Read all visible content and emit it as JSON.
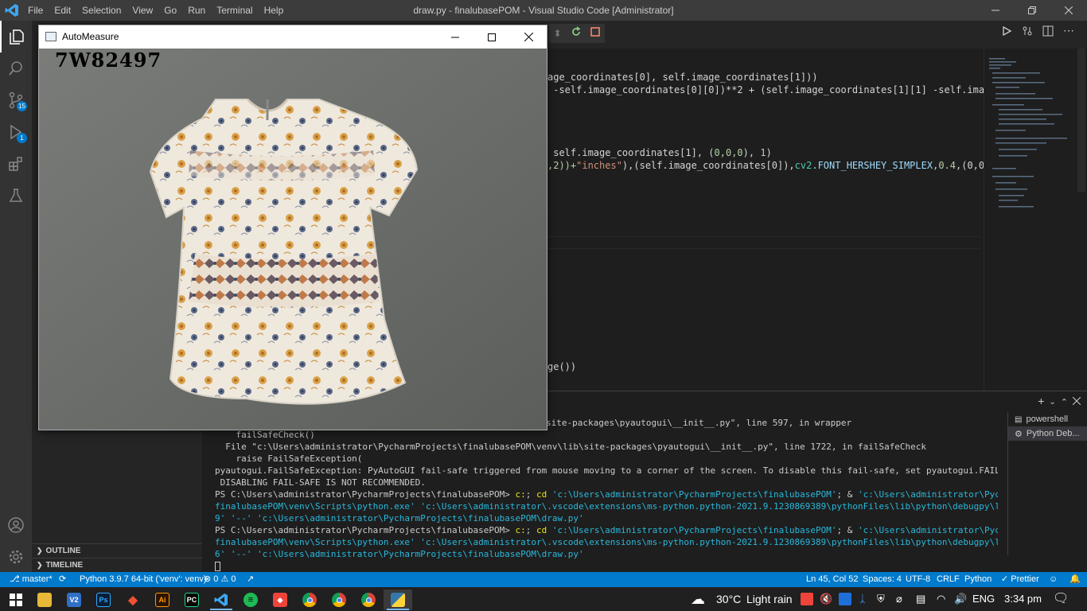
{
  "window": {
    "title": "draw.py - finalubasePOM - Visual Studio Code [Administrator]",
    "menu": [
      "File",
      "Edit",
      "Selection",
      "View",
      "Go",
      "Run",
      "Terminal",
      "Help"
    ]
  },
  "activity": {
    "source_control_badge": "15",
    "debug_badge": "1"
  },
  "sidebar": {
    "outline_label": "OUTLINE",
    "timeline_label": "TIMELINE"
  },
  "editor": {
    "lines": {
      "l1": "age_coordinates[0], self.image_coordinates[1]))",
      "l2": " -self.image_coordinates[0][0])**2 + (self.image_coordinates[1][1] -self.image_coordi",
      "l3a": " self.image_coordinates[1], (",
      "l3b": "0,0,0",
      "l3c": "), ",
      "l3d": "1",
      "l3e": ")",
      "l4a": ",2))+",
      "l4b": "\"inches\"",
      "l4c": "),(self.image_coordinates[0]),",
      "l4d": "cv2",
      "l4e": ".FONT_HERSHEY_SIMPLEX,",
      "l4f": "0.4",
      "l4g": ",(0,0,0),1)",
      "l5": "ge())"
    }
  },
  "terminal": {
    "lines": [
      "site-packages\\pyautogui\\__init__.py\", line 597, in wrapper",
      "    failSafeCheck()",
      "  File \"c:\\Users\\administrator\\PycharmProjects\\finalubasePOM\\venv\\lib\\site-packages\\pyautogui\\__init__.py\", line 1722, in failSafeCheck",
      "    raise FailSafeException(",
      "pyautogui.FailSafeException: PyAutoGUI fail-safe triggered from mouse moving to a corner of the screen. To disable this fail-safe, set pyautogui.FAILSAFE to False.",
      " DISABLING FAIL-SAFE IS NOT RECOMMENDED."
    ],
    "cmd1": {
      "prompt": "PS C:\\Users\\administrator\\PycharmProjects\\finalubasePOM> ",
      "c": "c:",
      "semi": "; ",
      "cd": "cd",
      "path": " 'c:\\Users\\administrator\\PycharmProjects\\finalubasePOM'",
      "amp": "; & ",
      "rest1": "'c:\\Users\\administrator\\PycharmProjects\\",
      "rest2": "finalubasePOM\\venv\\Scripts\\python.exe' 'c:\\Users\\administrator\\.vscode\\extensions\\ms-python.python-2021.9.1230869389\\pythonFiles\\lib\\python\\debugpy\\launcher' '5213",
      "rest3": "9' '--' 'c:\\Users\\administrator\\PycharmProjects\\finalubasePOM\\draw.py'"
    },
    "cmd2": {
      "prompt": "PS C:\\Users\\administrator\\PycharmProjects\\finalubasePOM> ",
      "c": "c:",
      "semi": "; ",
      "cd": "cd",
      "path": " 'c:\\Users\\administrator\\PycharmProjects\\finalubasePOM'",
      "amp": "; & ",
      "rest1": "'c:\\Users\\administrator\\PycharmProjects\\",
      "rest2": "finalubasePOM\\venv\\Scripts\\python.exe' 'c:\\Users\\administrator\\.vscode\\extensions\\ms-python.python-2021.9.1230869389\\pythonFiles\\lib\\python\\debugpy\\launcher' '5214",
      "rest3": "6' '--' 'c:\\Users\\administrator\\PycharmProjects\\finalubasePOM\\draw.py'"
    },
    "instances": [
      "powershell",
      "Python Deb..."
    ]
  },
  "statusbar": {
    "branch": "master*",
    "interpreter": "Python 3.9.7 64-bit ('venv': venv)",
    "errors": "0",
    "warnings": "0",
    "position": "Ln 45, Col 52",
    "spaces": "Spaces: 4",
    "encoding": "UTF-8",
    "eol": "CRLF",
    "language": "Python",
    "prettier": "Prettier"
  },
  "automeasure": {
    "title": "AutoMeasure",
    "label": "7W82497"
  },
  "taskbar": {
    "weather_temp": "30°C",
    "weather_text": "Light rain",
    "language": "ENG",
    "time": "3:34 pm",
    "app_labels": [
      "V2",
      "Ps",
      "Ai",
      "PC"
    ]
  },
  "colors": {
    "accent": "#007acc",
    "titlebar": "#3c3c3c",
    "activitybar": "#333333",
    "sidebar": "#252526",
    "editor": "#1e1e1e",
    "taskbar": "#202020"
  }
}
